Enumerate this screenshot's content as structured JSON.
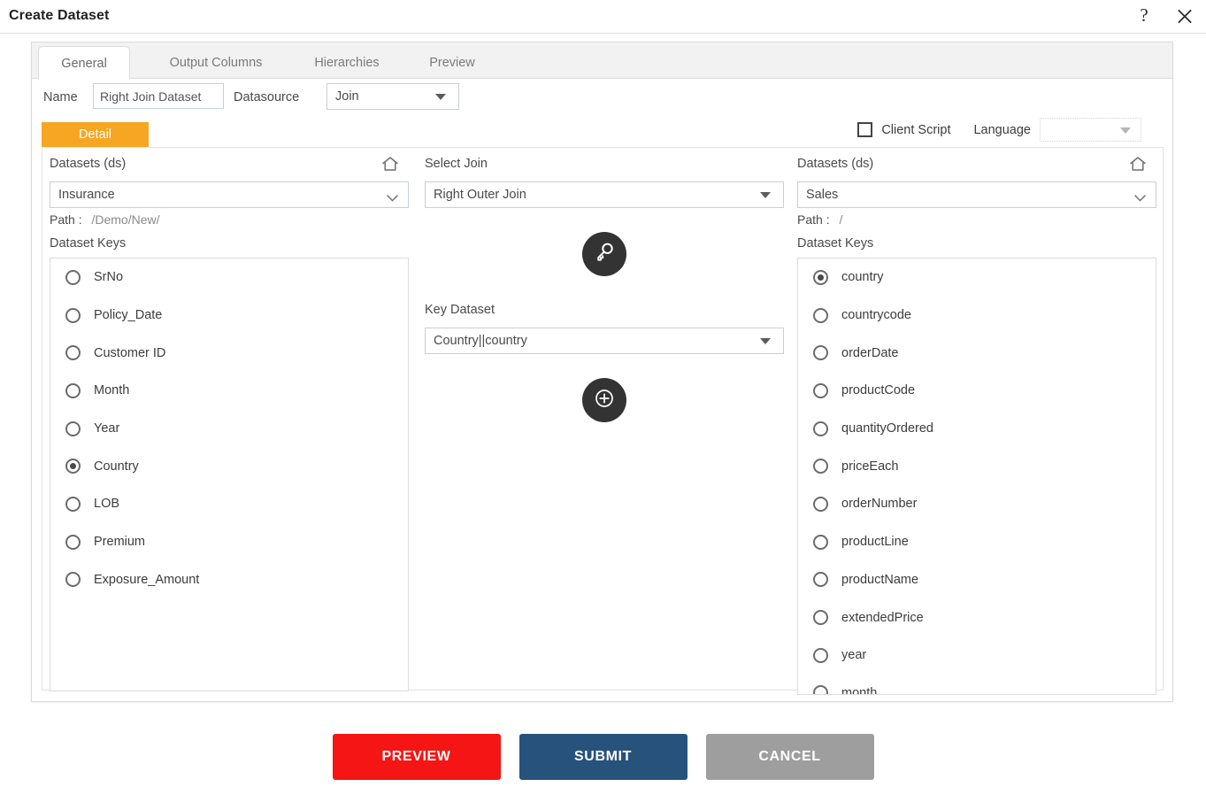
{
  "window": {
    "title": "Create Dataset",
    "help_icon": "question-mark-icon",
    "close_icon": "close-icon"
  },
  "tabs": [
    {
      "label": "General",
      "active": true
    },
    {
      "label": "Output Columns",
      "active": false
    },
    {
      "label": "Hierarchies",
      "active": false
    },
    {
      "label": "Preview",
      "active": false
    }
  ],
  "form": {
    "name_label": "Name",
    "name_value": "Right Join Dataset",
    "name_placeholder": "",
    "datasource_label": "Datasource",
    "datasource_value": "Join"
  },
  "options": {
    "client_script_label": "Client Script",
    "client_script_checked": false,
    "language_label": "Language",
    "language_value": ""
  },
  "detail_tab": {
    "label": "Detail"
  },
  "left_panel": {
    "title": "Datasets (ds)",
    "home_icon": "home-icon",
    "dataset_value": "Insurance",
    "path_label": "Path :",
    "path_value": "/Demo/New/",
    "keys_label": "Dataset Keys",
    "keys": [
      {
        "label": "SrNo",
        "selected": false
      },
      {
        "label": "Policy_Date",
        "selected": false
      },
      {
        "label": "Customer ID",
        "selected": false
      },
      {
        "label": "Month",
        "selected": false
      },
      {
        "label": "Year",
        "selected": false
      },
      {
        "label": "Country",
        "selected": true
      },
      {
        "label": "LOB",
        "selected": false
      },
      {
        "label": "Premium",
        "selected": false
      },
      {
        "label": "Exposure_Amount",
        "selected": false
      }
    ]
  },
  "middle_panel": {
    "join_label": "Select Join",
    "join_value": "Right Outer Join",
    "key_button_icon": "key-icon",
    "key_dataset_label": "Key Dataset",
    "key_dataset_value": "Country||country",
    "add_button_icon": "plus-circle-icon"
  },
  "right_panel": {
    "title": "Datasets (ds)",
    "home_icon": "home-icon",
    "dataset_value": "Sales",
    "path_label": "Path :",
    "path_value": "/",
    "keys_label": "Dataset Keys",
    "keys": [
      {
        "label": "country",
        "selected": true
      },
      {
        "label": "countrycode",
        "selected": false
      },
      {
        "label": "orderDate",
        "selected": false
      },
      {
        "label": "productCode",
        "selected": false
      },
      {
        "label": "quantityOrdered",
        "selected": false
      },
      {
        "label": "priceEach",
        "selected": false
      },
      {
        "label": "orderNumber",
        "selected": false
      },
      {
        "label": "productLine",
        "selected": false
      },
      {
        "label": "productName",
        "selected": false
      },
      {
        "label": "extendedPrice",
        "selected": false
      },
      {
        "label": "year",
        "selected": false
      },
      {
        "label": "month",
        "selected": false
      }
    ]
  },
  "footer": {
    "preview_label": "PREVIEW",
    "submit_label": "SUBMIT",
    "cancel_label": "CANCEL"
  },
  "colors": {
    "detail_tab": "#f6a623",
    "preview_button": "#f51515",
    "submit_button": "#27527c",
    "cancel_button": "#9e9e9e",
    "round_button": "#333333"
  }
}
